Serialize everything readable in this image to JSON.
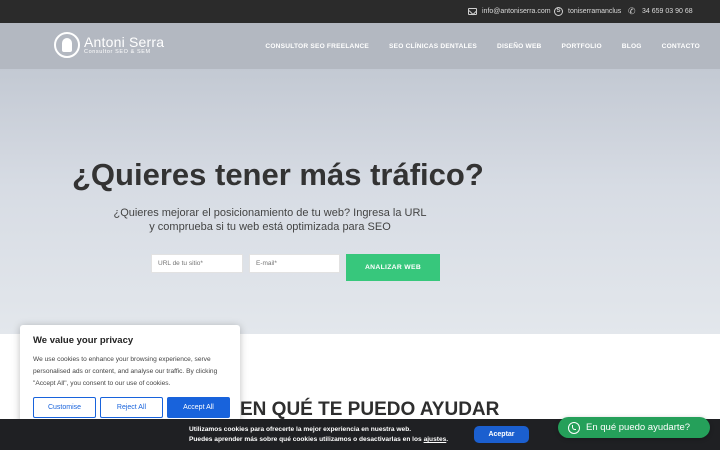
{
  "topbar": {
    "email": "info@antoniserra.com",
    "skype": "toniserramanclus",
    "phone": "34 659 03 90 68",
    "icons": [
      "mail-icon",
      "skype-icon",
      "phone-icon"
    ]
  },
  "header": {
    "logo_name": "Antoni Serra",
    "logo_sub": "Consultor SEO & SEM",
    "nav": [
      "CONSULTOR SEO FREELANCE",
      "SEO CLÍNICAS DENTALES",
      "DISEÑO WEB",
      "PORTFOLIO",
      "BLOG",
      "CONTACTO"
    ]
  },
  "hero": {
    "title": "¿Quieres tener más tráfico?",
    "subtitle_line1": "¿Quieres mejorar el posicionamiento de tu web? Ingresa la URL",
    "subtitle_line2": "y comprueba si tu web está optimizada para SEO",
    "url_placeholder": "URL de tu sitio*",
    "email_placeholder": "E-mail*",
    "analyze_label": "ANALIZAR WEB"
  },
  "section": {
    "heading": "EN QUÉ TE PUEDO AYUDAR"
  },
  "consent": {
    "title": "We value your privacy",
    "text": "We use cookies to enhance your browsing experience, serve personalised ads or content, and analyse our traffic. By clicking \"Accept All\", you consent to our use of cookies.",
    "customise_label": "Customise",
    "reject_label": "Reject All",
    "accept_label": "Accept All",
    "accent_color": "#1863dc"
  },
  "cookiebar": {
    "line1": "Utilizamos cookies para ofrecerte la mejor experiencia en nuestra web.",
    "line2": "Puedes aprender más sobre qué cookies utilizamos o desactivarlas en los",
    "link": "ajustes",
    "accept_label": "Aceptar"
  },
  "whatsapp": {
    "label": "En qué puedo ayudarte?",
    "color": "#25a05a"
  }
}
